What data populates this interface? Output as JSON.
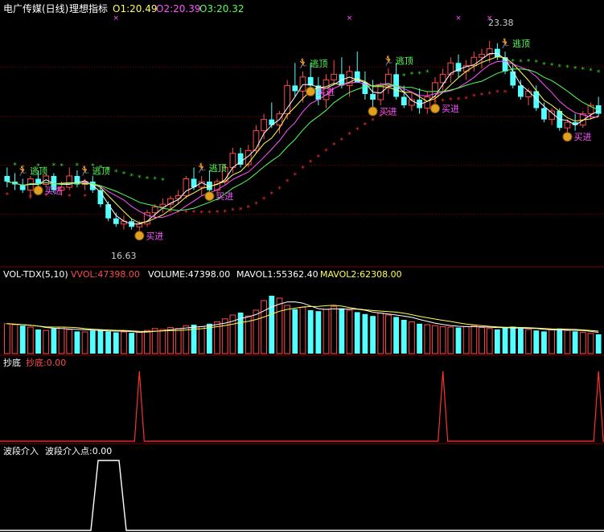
{
  "header": {
    "title": "电广传媒(日线)",
    "indicator": "理想指标",
    "o1": "O1:20.49",
    "o2": "O2:20.39",
    "o3": "O3:20.32"
  },
  "price_panel": {
    "high_label": "23.38",
    "low_label": "16.63",
    "signal_buy": "买进",
    "signal_escape": "逃顶"
  },
  "vol_panel": {
    "name": "VOL-TDX(5,10)",
    "vvol": "VVOL:47398.00",
    "volume": "VOLUME:47398.00",
    "mavol1": "MAVOL1:55362.40",
    "mavol2": "MAVOL2:62308.00"
  },
  "dip_panel": {
    "name": "抄底",
    "value": "抄底:0.00"
  },
  "wave_panel": {
    "name": "波段介入",
    "value": "波段介入点:0.00"
  },
  "colors": {
    "up": "#ff4a4a",
    "down": "#54ffff",
    "grid": "#800000",
    "ma1": "#ffffff",
    "ma2": "#ffff55",
    "ma3": "#ff55ff",
    "ma4": "#55ff55",
    "buy_text": "#ff55ff",
    "escape_text": "#55ff55",
    "dot_red": "#ff3030",
    "dot_green": "#33dd33"
  },
  "chart_data": [
    {
      "type": "candlestick",
      "ylim": [
        15.5,
        24.2
      ],
      "ohlc": [
        [
          18.6,
          18.9,
          18.2,
          18.4
        ],
        [
          18.4,
          18.7,
          18.1,
          18.3
        ],
        [
          18.3,
          18.5,
          18.0,
          18.1
        ],
        [
          18.1,
          18.6,
          17.8,
          18.5
        ],
        [
          18.5,
          18.8,
          18.2,
          18.3
        ],
        [
          18.3,
          18.7,
          18.2,
          18.6
        ],
        [
          18.6,
          18.7,
          18.0,
          18.1
        ],
        [
          18.1,
          18.4,
          17.9,
          18.2
        ],
        [
          18.2,
          18.9,
          18.1,
          18.6
        ],
        [
          18.6,
          18.8,
          18.2,
          18.3
        ],
        [
          18.3,
          18.5,
          18.1,
          18.4
        ],
        [
          18.4,
          18.6,
          18.0,
          18.1
        ],
        [
          18.1,
          18.2,
          17.5,
          17.6
        ],
        [
          17.6,
          17.7,
          17.0,
          17.1
        ],
        [
          17.1,
          17.3,
          16.8,
          16.9
        ],
        [
          16.9,
          17.2,
          16.7,
          17.0
        ],
        [
          17.0,
          17.1,
          16.7,
          16.8
        ],
        [
          16.8,
          17.0,
          16.6,
          16.9
        ],
        [
          16.9,
          17.4,
          16.8,
          17.3
        ],
        [
          17.3,
          17.6,
          17.1,
          17.5
        ],
        [
          17.5,
          17.8,
          17.3,
          17.6
        ],
        [
          17.6,
          17.9,
          17.4,
          17.8
        ],
        [
          17.8,
          18.1,
          17.6,
          17.9
        ],
        [
          17.9,
          18.6,
          17.8,
          18.5
        ],
        [
          18.5,
          18.9,
          18.1,
          18.2
        ],
        [
          18.2,
          18.6,
          17.9,
          18.4
        ],
        [
          18.4,
          18.8,
          18.0,
          18.1
        ],
        [
          18.1,
          18.5,
          17.9,
          18.4
        ],
        [
          18.4,
          19.0,
          18.3,
          18.9
        ],
        [
          18.9,
          19.6,
          18.7,
          19.4
        ],
        [
          19.4,
          19.6,
          18.9,
          19.0
        ],
        [
          19.0,
          19.7,
          18.9,
          19.5
        ],
        [
          19.5,
          20.4,
          19.4,
          20.2
        ],
        [
          20.2,
          20.8,
          19.9,
          20.6
        ],
        [
          20.6,
          21.2,
          20.3,
          20.4
        ],
        [
          20.4,
          20.9,
          20.1,
          20.8
        ],
        [
          20.8,
          22.0,
          20.6,
          21.8
        ],
        [
          21.8,
          22.6,
          21.4,
          21.6
        ],
        [
          21.6,
          22.3,
          21.2,
          22.1
        ],
        [
          22.1,
          22.6,
          21.7,
          21.8
        ],
        [
          21.8,
          22.1,
          21.1,
          21.3
        ],
        [
          21.3,
          22.2,
          21.0,
          22.0
        ],
        [
          22.0,
          22.7,
          21.8,
          22.2
        ],
        [
          22.2,
          22.8,
          21.7,
          21.8
        ],
        [
          21.8,
          22.5,
          21.4,
          22.3
        ],
        [
          22.3,
          23.0,
          22.0,
          21.9
        ],
        [
          21.9,
          22.3,
          21.3,
          21.5
        ],
        [
          21.5,
          22.0,
          21.0,
          21.3
        ],
        [
          21.3,
          21.9,
          21.1,
          21.8
        ],
        [
          21.8,
          22.4,
          21.5,
          22.2
        ],
        [
          22.2,
          22.6,
          21.3,
          21.4
        ],
        [
          21.4,
          21.8,
          21.0,
          21.1
        ],
        [
          21.1,
          21.6,
          20.9,
          21.3
        ],
        [
          21.3,
          21.7,
          20.8,
          21.0
        ],
        [
          21.0,
          21.6,
          20.8,
          21.4
        ],
        [
          21.4,
          22.1,
          21.1,
          21.9
        ],
        [
          21.9,
          22.4,
          21.6,
          22.2
        ],
        [
          22.2,
          22.8,
          21.9,
          22.6
        ],
        [
          22.6,
          22.9,
          22.1,
          22.3
        ],
        [
          22.3,
          22.7,
          22.0,
          22.5
        ],
        [
          22.5,
          23.0,
          22.3,
          22.8
        ],
        [
          22.8,
          23.1,
          22.4,
          22.9
        ],
        [
          22.9,
          23.38,
          22.6,
          23.1
        ],
        [
          23.1,
          23.3,
          22.7,
          22.8
        ],
        [
          22.8,
          23.0,
          22.2,
          22.3
        ],
        [
          22.3,
          22.6,
          21.7,
          21.8
        ],
        [
          21.8,
          22.0,
          21.3,
          21.4
        ],
        [
          21.4,
          21.7,
          21.1,
          21.6
        ],
        [
          21.6,
          21.8,
          20.9,
          21.0
        ],
        [
          21.0,
          21.2,
          20.5,
          20.6
        ],
        [
          20.6,
          21.0,
          20.4,
          20.9
        ],
        [
          20.9,
          21.0,
          20.2,
          20.3
        ],
        [
          20.3,
          20.6,
          20.1,
          20.5
        ],
        [
          20.5,
          20.8,
          20.2,
          20.4
        ],
        [
          20.4,
          20.9,
          20.3,
          20.8
        ],
        [
          20.8,
          21.2,
          20.6,
          21.1
        ],
        [
          21.1,
          21.4,
          20.7,
          20.8
        ]
      ]
    },
    {
      "type": "bar",
      "ylim": [
        0,
        150
      ],
      "values": [
        62,
        60,
        58,
        55,
        50,
        48,
        52,
        55,
        50,
        46,
        45,
        48,
        50,
        46,
        44,
        45,
        43,
        44,
        48,
        52,
        50,
        54,
        52,
        58,
        60,
        56,
        62,
        66,
        72,
        80,
        85,
        78,
        90,
        110,
        120,
        115,
        100,
        92,
        96,
        90,
        88,
        92,
        98,
        94,
        90,
        86,
        82,
        78,
        84,
        80,
        76,
        70,
        66,
        62,
        60,
        58,
        56,
        55,
        54,
        56,
        58,
        54,
        52,
        50,
        54,
        56,
        52,
        50,
        48,
        46,
        50,
        52,
        48,
        46,
        44,
        42,
        40
      ],
      "up": [
        true,
        true,
        false,
        true,
        false,
        true,
        false,
        true,
        true,
        false,
        true,
        false,
        false,
        false,
        false,
        true,
        false,
        true,
        true,
        true,
        true,
        true,
        true,
        true,
        false,
        true,
        false,
        true,
        true,
        true,
        false,
        true,
        true,
        true,
        false,
        true,
        true,
        false,
        true,
        false,
        false,
        true,
        true,
        false,
        true,
        false,
        false,
        false,
        true,
        true,
        false,
        false,
        true,
        false,
        true,
        true,
        true,
        true,
        false,
        true,
        true,
        true,
        true,
        false,
        false,
        false,
        false,
        true,
        false,
        false,
        true,
        false,
        true,
        false,
        true,
        true,
        false
      ]
    }
  ]
}
